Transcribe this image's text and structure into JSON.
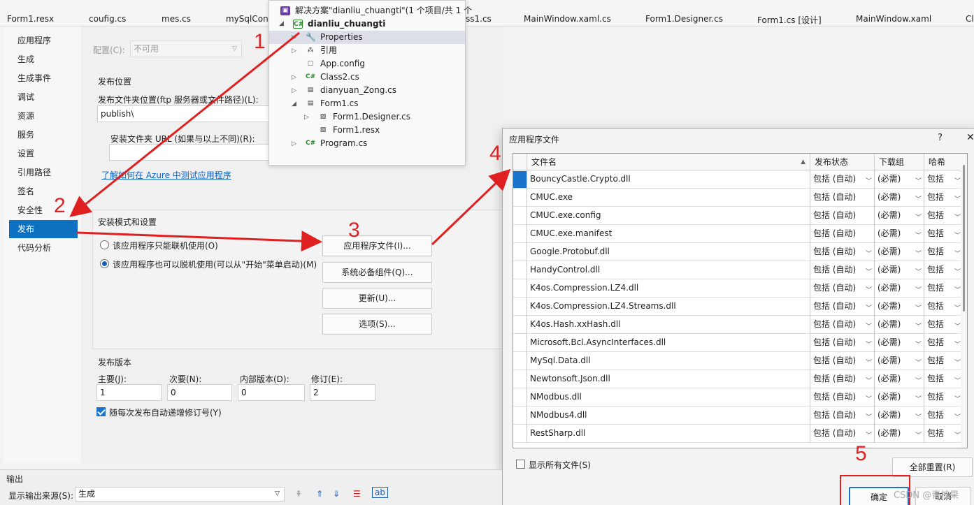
{
  "tabs": [
    "Form1.resx",
    "coufig.cs",
    "mes.cs",
    "mySqlCon",
    "ss1.cs",
    "MainWindow.xaml.cs",
    "Form1.Designer.cs",
    "Form1.cs [设计]",
    "MainWindow.xaml",
    "Cl"
  ],
  "nav": {
    "items": [
      "应用程序",
      "生成",
      "生成事件",
      "调试",
      "资源",
      "服务",
      "设置",
      "引用路径",
      "签名",
      "安全性",
      "发布",
      "代码分析"
    ],
    "active": "发布"
  },
  "publish": {
    "config_label": "配置(C):",
    "config_value": "不可用",
    "location_section": "发布位置",
    "folder_label": "发布文件夹位置(ftp 服务器或文件路径)(L):",
    "folder_value": "publish\\",
    "install_url_label": "安装文件夹 URL (如果与以上不同)(R):",
    "azure_link": "了解如何在 Azure 中测试应用程序",
    "install_section": "安装模式和设置",
    "online_only": "该应用程序只能联机使用(O)",
    "offline": "该应用程序也可以脱机使用(可以从\"开始\"菜单启动)(M)",
    "btn_app_files": "应用程序文件(I)...",
    "btn_prereq": "系统必备组件(Q)...",
    "btn_updates": "更新(U)...",
    "btn_options": "选项(S)...",
    "version_section": "发布版本",
    "major_label": "主要(J):",
    "minor_label": "次要(N):",
    "build_label": "内部版本(D):",
    "revision_label": "修订(E):",
    "major": "1",
    "minor": "0",
    "build": "0",
    "revision": "2",
    "auto_increment": "随每次发布自动递增修订号(Y)"
  },
  "solution": {
    "header": "解决方案\"dianliu_chuangti\"(1 个项目/共 1 个",
    "project": "dianliu_chuangti",
    "nodes": [
      "Properties",
      "引用",
      "App.config",
      "Class2.cs",
      "dianyuan_Zong.cs",
      "Form1.cs",
      "Form1.Designer.cs",
      "Form1.resx",
      "Program.cs"
    ]
  },
  "dialog": {
    "title": "应用程序文件",
    "help": "?",
    "close": "✕",
    "columns": [
      "文件名",
      "发布状态",
      "下载组",
      "哈希"
    ],
    "rows": [
      {
        "name": "BouncyCastle.Crypto.dll",
        "status": "包括 (自动)",
        "group": "(必需)",
        "hash": "包括",
        "has_dd": true
      },
      {
        "name": "CMUC.exe",
        "status": "包括 (自动)",
        "group": "(必需)",
        "hash": "包括",
        "has_dd": false
      },
      {
        "name": "CMUC.exe.config",
        "status": "包括 (自动)",
        "group": "(必需)",
        "hash": "包括",
        "has_dd": false
      },
      {
        "name": "CMUC.exe.manifest",
        "status": "包括 (自动)",
        "group": "(必需)",
        "hash": "包括",
        "has_dd": false
      },
      {
        "name": "Google.Protobuf.dll",
        "status": "包括 (自动)",
        "group": "(必需)",
        "hash": "包括",
        "has_dd": true
      },
      {
        "name": "HandyControl.dll",
        "status": "包括 (自动)",
        "group": "(必需)",
        "hash": "包括",
        "has_dd": true
      },
      {
        "name": "K4os.Compression.LZ4.dll",
        "status": "包括 (自动)",
        "group": "(必需)",
        "hash": "包括",
        "has_dd": true
      },
      {
        "name": "K4os.Compression.LZ4.Streams.dll",
        "status": "包括 (自动)",
        "group": "(必需)",
        "hash": "包括",
        "has_dd": true
      },
      {
        "name": "K4os.Hash.xxHash.dll",
        "status": "包括 (自动)",
        "group": "(必需)",
        "hash": "包括",
        "has_dd": true
      },
      {
        "name": "Microsoft.Bcl.AsyncInterfaces.dll",
        "status": "包括 (自动)",
        "group": "(必需)",
        "hash": "包括",
        "has_dd": true
      },
      {
        "name": "MySql.Data.dll",
        "status": "包括 (自动)",
        "group": "(必需)",
        "hash": "包括",
        "has_dd": true
      },
      {
        "name": "Newtonsoft.Json.dll",
        "status": "包括 (自动)",
        "group": "(必需)",
        "hash": "包括",
        "has_dd": true
      },
      {
        "name": "NModbus.dll",
        "status": "包括 (自动)",
        "group": "(必需)",
        "hash": "包括",
        "has_dd": true
      },
      {
        "name": "NModbus4.dll",
        "status": "包括 (自动)",
        "group": "(必需)",
        "hash": "包括",
        "has_dd": true
      },
      {
        "name": "RestSharp.dll",
        "status": "包括 (自动)",
        "group": "(必需)",
        "hash": "包括",
        "has_dd": true
      }
    ],
    "show_all": "显示所有文件(S)",
    "reset_all": "全部重置(R)",
    "ok": "确定",
    "cancel": "取消"
  },
  "output": {
    "title": "输出",
    "source_label": "显示输出来源(S):",
    "source_value": "生成"
  },
  "annotations": [
    "1",
    "2",
    "3",
    "4",
    "5"
  ],
  "watermark": "CSDN @青柠果",
  "colors": {
    "accent": "#0e70c0",
    "annotation": "#e02020"
  }
}
